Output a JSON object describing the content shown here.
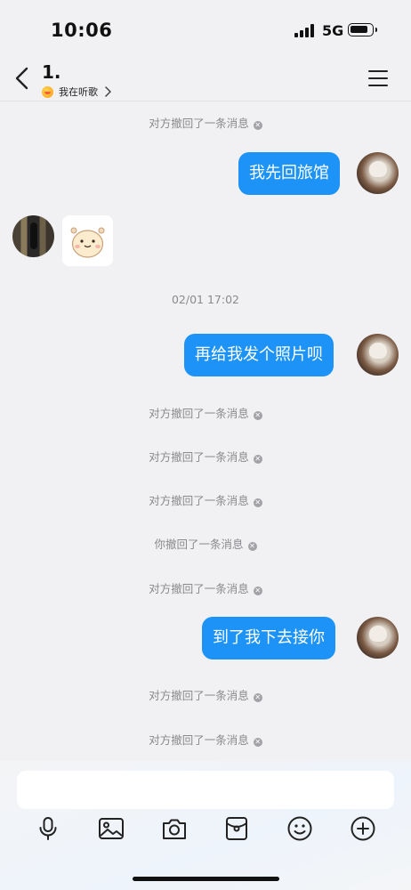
{
  "status_bar": {
    "time": "10:06",
    "network": "5G"
  },
  "header": {
    "title": "1.",
    "subtitle": "我在听歌"
  },
  "messages": {
    "recall_peer": "对方撤回了一条消息",
    "recall_self": "你撤回了一条消息",
    "recall_icon": "x-circle-icon",
    "m1": "我先回旅馆",
    "timestamp": "02/01 17:02",
    "m2": "再给我发个照片呗",
    "m3": "到了我下去接你"
  },
  "composer": {
    "input_value": "",
    "tools": [
      "microphone-icon",
      "image-icon",
      "camera-icon",
      "red-packet-icon",
      "emoji-icon",
      "plus-icon"
    ]
  },
  "colors": {
    "outgoing_bubble": "#1d93f7",
    "background": "#f1f1f3"
  }
}
